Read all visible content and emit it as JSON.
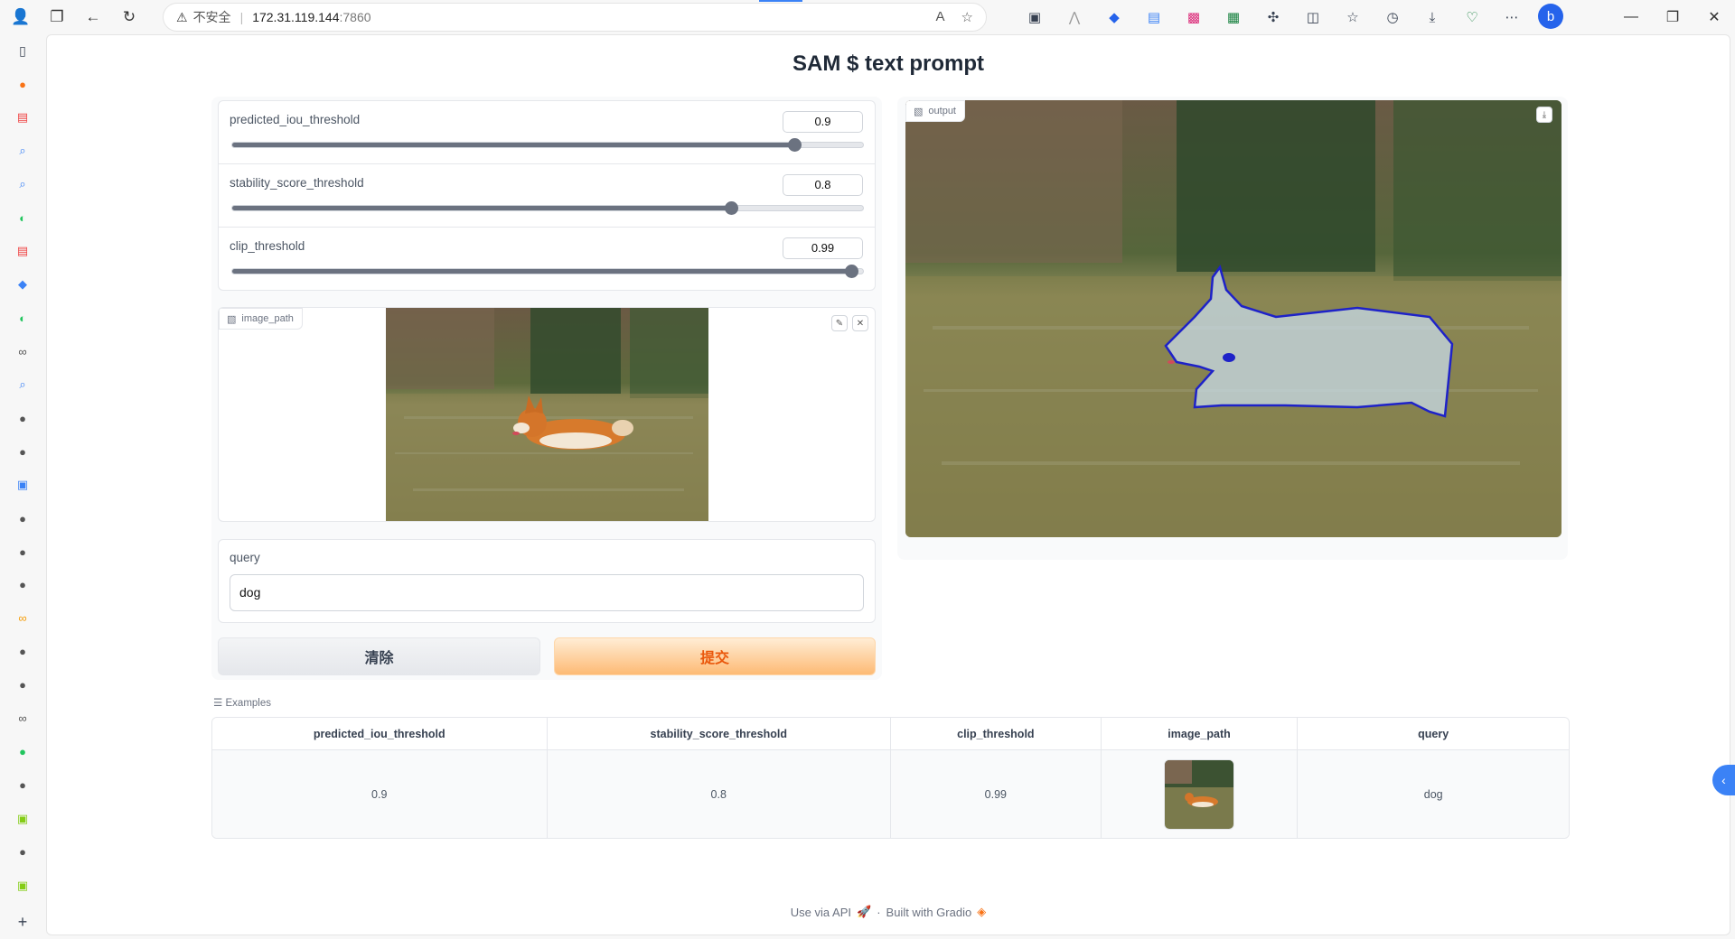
{
  "browser": {
    "security_label": "不安全",
    "url_host": "172.31.119.144",
    "url_port": ":7860",
    "extensions": [
      "tab-icon",
      "tag-icon",
      "bookmark-icon",
      "doc-icon",
      "translate-icon",
      "note-icon",
      "puzzle-icon",
      "split-icon",
      "favorites-icon",
      "history-icon",
      "download-icon",
      "heart-icon",
      "more-icon",
      "bing-icon"
    ]
  },
  "app": {
    "title": "SAM $ text prompt",
    "sliders": [
      {
        "label": "predicted_iou_threshold",
        "value": "0.9",
        "fraction": 0.89
      },
      {
        "label": "stability_score_threshold",
        "value": "0.8",
        "fraction": 0.79
      },
      {
        "label": "clip_threshold",
        "value": "0.99",
        "fraction": 0.98
      }
    ],
    "image_input_label": "image_path",
    "query_label": "query",
    "query_value": "dog",
    "clear_label": "清除",
    "submit_label": "提交",
    "output_label": "output"
  },
  "examples": {
    "title": "Examples",
    "headers": [
      "predicted_iou_threshold",
      "stability_score_threshold",
      "clip_threshold",
      "image_path",
      "query"
    ],
    "row": {
      "iou": "0.9",
      "stability": "0.8",
      "clip": "0.99",
      "query": "dog"
    }
  },
  "footer": {
    "api_label": "Use via API",
    "built_label": "Built with Gradio"
  },
  "colors": {
    "accent_orange": "#ea580c",
    "mask_outline": "#1e22c8",
    "browser_blue": "#3b82f6"
  }
}
